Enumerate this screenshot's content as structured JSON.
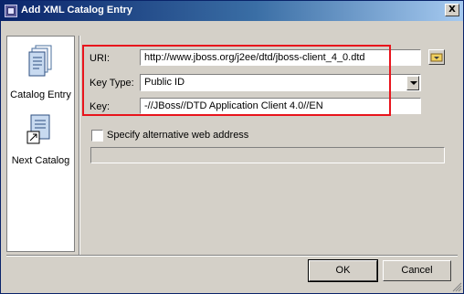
{
  "window": {
    "title": "Add XML Catalog Entry",
    "close_glyph": "X"
  },
  "sidebar": {
    "items": [
      {
        "label": "Catalog Entry",
        "icon": "catalog-entry-icon"
      },
      {
        "label": "Next Catalog",
        "icon": "next-catalog-icon"
      }
    ]
  },
  "form": {
    "uri": {
      "label": "URI:",
      "value": "http://www.jboss.org/j2ee/dtd/jboss-client_4_0.dtd"
    },
    "key_type": {
      "label": "Key Type:",
      "value": "Public ID"
    },
    "key": {
      "label": "Key:",
      "value": "-//JBoss//DTD Application Client 4.0//EN"
    },
    "alt_web": {
      "label": "Specify alternative web address",
      "checked": false,
      "value": ""
    }
  },
  "buttons": {
    "ok": "OK",
    "cancel": "Cancel"
  },
  "colors": {
    "highlight": "#e8141c",
    "title_bar": "#0a246a",
    "dialog_bg": "#d4d0c8"
  }
}
